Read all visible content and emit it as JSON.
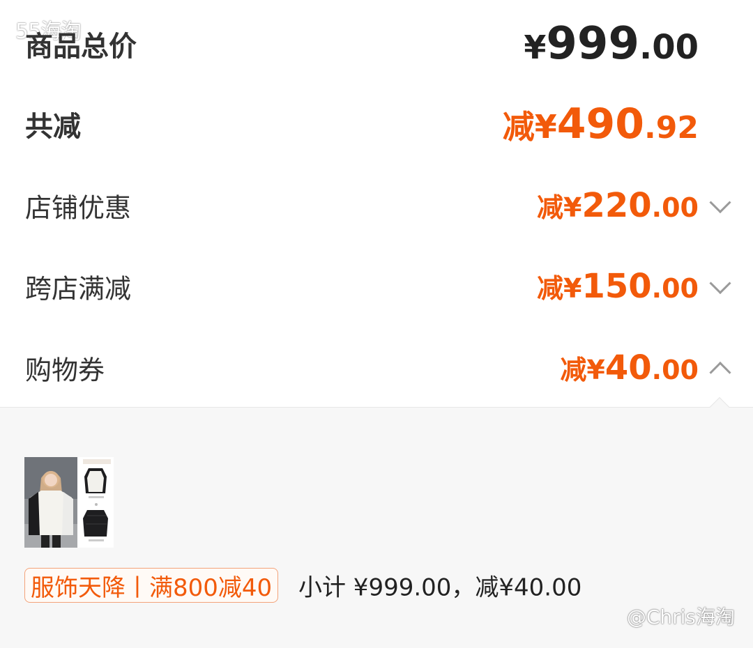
{
  "watermarks": {
    "top_left": "55海淘",
    "bottom_right": "@Chris海淘"
  },
  "summary": {
    "total": {
      "label": "商品总价",
      "currency": "¥",
      "int": "999",
      "dec": ".00"
    },
    "reduction": {
      "label": "共减",
      "prefix": "减",
      "currency": "¥",
      "int": "490",
      "dec": ".92"
    }
  },
  "discounts": [
    {
      "label": "店铺优惠",
      "prefix": "减",
      "currency": "¥",
      "int": "220",
      "dec": ".00",
      "chevron": "chevron-down-icon"
    },
    {
      "label": "跨店满减",
      "prefix": "减",
      "currency": "¥",
      "int": "150",
      "dec": ".00",
      "chevron": "chevron-down-icon"
    },
    {
      "label": "购物券",
      "prefix": "减",
      "currency": "¥",
      "int": "40",
      "dec": ".00",
      "chevron": "chevron-up-icon"
    }
  ],
  "coupon_detail": {
    "product_image": "jacket-product-thumbnail",
    "promo_tag": "服饰天降丨满800减40",
    "subtotal_text": "小计 ¥999.00，减¥40.00"
  },
  "colors": {
    "accent_orange": "#f25a0a",
    "panel_bg": "#f7f7f7",
    "text_dark": "#222222"
  }
}
